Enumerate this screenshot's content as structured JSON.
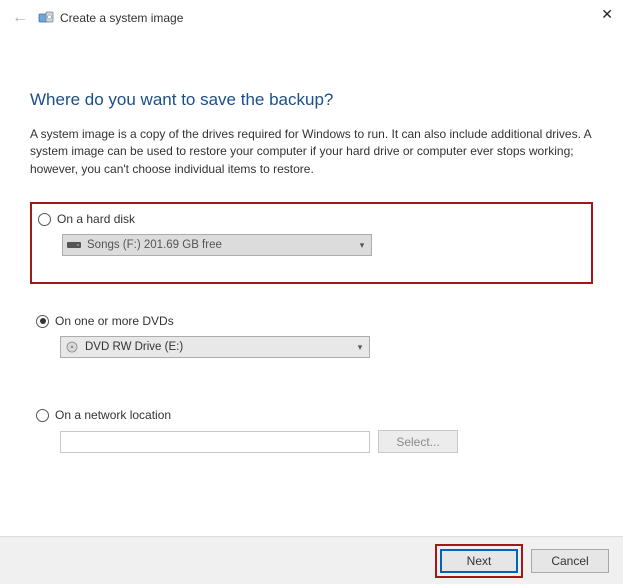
{
  "titlebar": {
    "title": "Create a system image",
    "close_glyph": "✕"
  },
  "heading": "Where do you want to save the backup?",
  "description": "A system image is a copy of the drives required for Windows to run. It can also include additional drives. A system image can be used to restore your computer if your hard drive or computer ever stops working; however, you can't choose individual items to restore.",
  "options": {
    "hard_disk": {
      "label": "On a hard disk",
      "selected": "Songs (F:)  201.69 GB free"
    },
    "dvd": {
      "label": "On one or more DVDs",
      "selected": "DVD RW Drive (E:)"
    },
    "network": {
      "label": "On a network location",
      "value": "",
      "select_btn": "Select..."
    }
  },
  "footer": {
    "next": "Next",
    "cancel": "Cancel"
  }
}
